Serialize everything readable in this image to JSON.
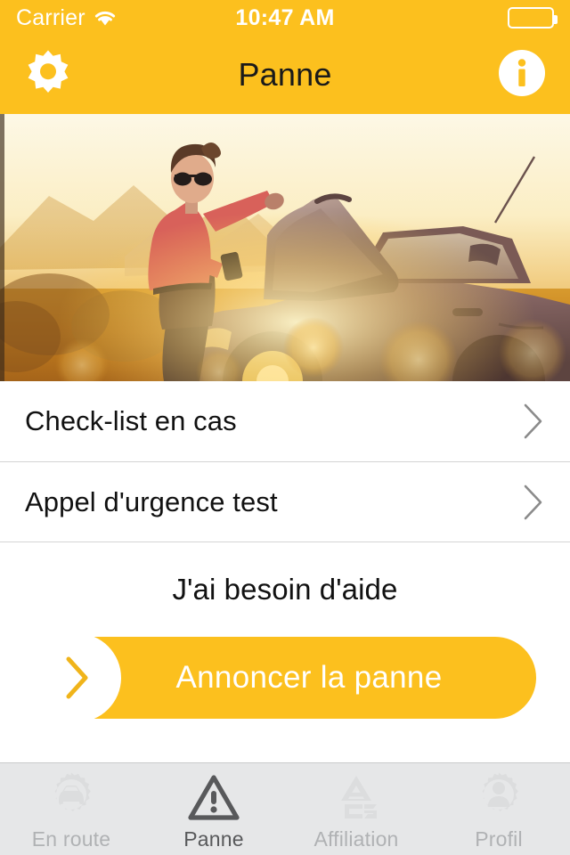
{
  "statusbar": {
    "carrier": "Carrier",
    "wifi_icon": "wifi-icon",
    "time": "10:47 AM",
    "battery_icon": "battery-full-icon"
  },
  "navbar": {
    "title": "Panne",
    "left_icon": "gear-icon",
    "right_icon": "info-circle-icon"
  },
  "hero": {
    "alt": "Woman with sunglasses standing beside a car with open hood at sunset, holding a mobile phone"
  },
  "list": {
    "rows": [
      {
        "label": "Check-list en cas",
        "chevron": "chevron-right-icon"
      },
      {
        "label": "Appel d'urgence test",
        "chevron": "chevron-right-icon"
      }
    ]
  },
  "cta": {
    "heading": "J'ai besoin d'aide",
    "button_label": "Annoncer la panne",
    "button_icon": "chevron-right-icon"
  },
  "tabbar": {
    "tabs": [
      {
        "label": "En route",
        "icon": "car-gear-icon",
        "active": false
      },
      {
        "label": "Panne",
        "icon": "warning-triangle-icon",
        "active": true
      },
      {
        "label": "Affiliation",
        "icon": "acs-logo-icon",
        "active": false
      },
      {
        "label": "Profil",
        "icon": "person-gear-icon",
        "active": false
      }
    ]
  },
  "colors": {
    "brand_yellow": "#FCC01E",
    "tabbar_bg": "#E6E7E8",
    "tab_inactive": "#B0B2B4",
    "tab_active": "#58595B",
    "separator": "#D4D4D4",
    "text": "#111111"
  }
}
